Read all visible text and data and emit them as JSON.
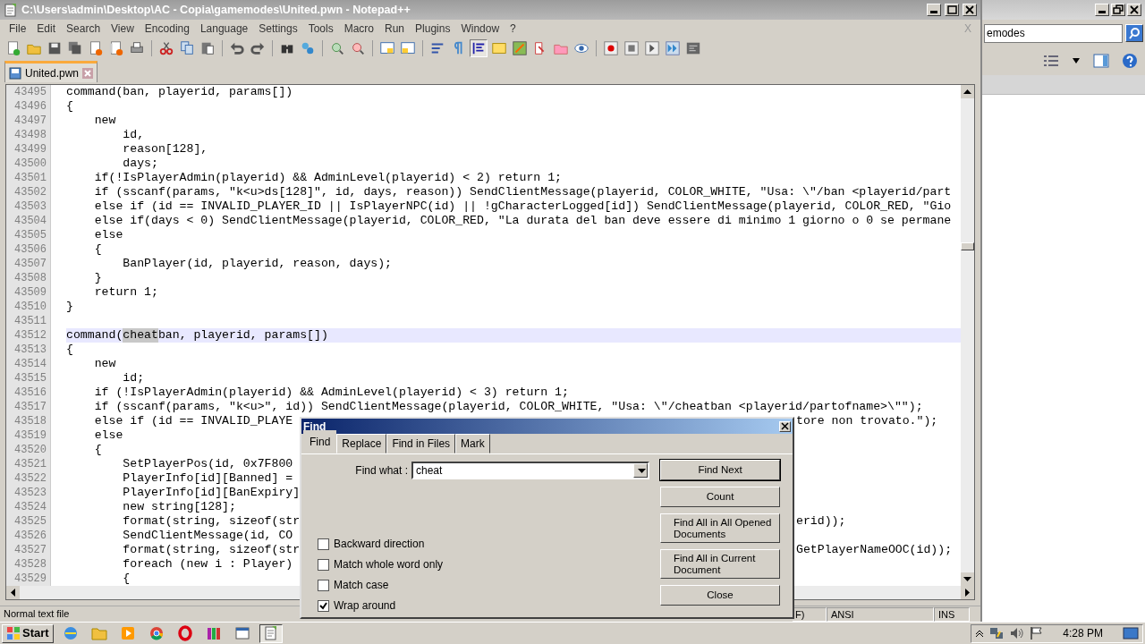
{
  "window": {
    "title": "C:\\Users\\admin\\Desktop\\AC - Copia\\gamemodes\\United.pwn - Notepad++"
  },
  "menu": [
    "File",
    "Edit",
    "Search",
    "View",
    "Encoding",
    "Language",
    "Settings",
    "Tools",
    "Macro",
    "Run",
    "Plugins",
    "Window",
    "?"
  ],
  "close_document": "X",
  "toolbar": {
    "indent_guide_pressed": true
  },
  "tabs": [
    {
      "label": "United.pwn",
      "selected": true
    }
  ],
  "editor": {
    "lines": [
      {
        "number": "43495",
        "text": "command(ban, playerid, params[])",
        "current": false
      },
      {
        "number": "43496",
        "text": "{",
        "current": false
      },
      {
        "number": "43497",
        "text": "    new",
        "current": false
      },
      {
        "number": "43498",
        "text": "        id,",
        "current": false
      },
      {
        "number": "43499",
        "text": "        reason[128],",
        "current": false
      },
      {
        "number": "43500",
        "text": "        days;",
        "current": false
      },
      {
        "number": "43501",
        "text": "    if(!IsPlayerAdmin(playerid) && AdminLevel(playerid) < 2) return 1;",
        "current": false
      },
      {
        "number": "43502",
        "text": "    if (sscanf(params, \"k<u>ds[128]\", id, days, reason)) SendClientMessage(playerid, COLOR_WHITE, \"Usa: \\\"/ban <playerid/part",
        "current": false
      },
      {
        "number": "43503",
        "text": "    else if (id == INVALID_PLAYER_ID || IsPlayerNPC(id) || !gCharacterLogged[id]) SendClientMessage(playerid, COLOR_RED, \"Gio",
        "current": false
      },
      {
        "number": "43504",
        "text": "    else if(days < 0) SendClientMessage(playerid, COLOR_RED, \"La durata del ban deve essere di minimo 1 giorno o 0 se permane",
        "current": false
      },
      {
        "number": "43505",
        "text": "    else",
        "current": false
      },
      {
        "number": "43506",
        "text": "    {",
        "current": false
      },
      {
        "number": "43507",
        "text": "        BanPlayer(id, playerid, reason, days);",
        "current": false
      },
      {
        "number": "43508",
        "text": "    }",
        "current": false
      },
      {
        "number": "43509",
        "text": "    return 1;",
        "current": false
      },
      {
        "number": "43510",
        "text": "}",
        "current": false
      },
      {
        "number": "43511",
        "current": false
      },
      {
        "number": "43512",
        "parts": [
          {
            "text": "command(",
            "match": false
          },
          {
            "text": "cheat",
            "match": true
          },
          {
            "text": "ban, playerid, params[])",
            "match": false
          }
        ],
        "current": true
      },
      {
        "number": "43513",
        "text": "{",
        "current": false
      },
      {
        "number": "43514",
        "text": "    new",
        "current": false
      },
      {
        "number": "43515",
        "text": "        id;",
        "current": false
      },
      {
        "number": "43516",
        "text": "    if (!IsPlayerAdmin(playerid) && AdminLevel(playerid) < 3) return 1;",
        "current": false
      },
      {
        "number": "43517",
        "text": "    if (sscanf(params, \"k<u>\", id)) SendClientMessage(playerid, COLOR_WHITE, \"Usa: \\\"/cheatban <playerid/partofname>\\\"\");",
        "current": false
      },
      {
        "number": "43518",
        "text": "    else if (id == INVALID_PLAYE",
        "tail": "tore non trovato.\");",
        "current": false
      },
      {
        "number": "43519",
        "text": "    else",
        "current": false
      },
      {
        "number": "43520",
        "text": "    {",
        "current": false
      },
      {
        "number": "43521",
        "text": "        SetPlayerPos(id, 0x7F800",
        "current": false
      },
      {
        "number": "43522",
        "text": "        PlayerInfo[id][Banned] =",
        "current": false
      },
      {
        "number": "43523",
        "text": "        PlayerInfo[id][BanExpiry]",
        "current": false
      },
      {
        "number": "43524",
        "text": "        new string[128];",
        "current": false
      },
      {
        "number": "43525",
        "text": "        format(string, sizeof(str",
        "tail": "erid));",
        "current": false
      },
      {
        "number": "43526",
        "text": "        SendClientMessage(id, CO",
        "current": false
      },
      {
        "number": "43527",
        "text": "        format(string, sizeof(str",
        "tail": "GetPlayerNameOOC(id));",
        "current": false
      },
      {
        "number": "43528",
        "text": "        foreach (new i : Player)",
        "current": false
      },
      {
        "number": "43529",
        "text": "        {",
        "current": false
      }
    ]
  },
  "status_bar": {
    "file_type": "Normal text file",
    "column_2": "F)",
    "encoding": "ANSI",
    "mode": "INS"
  },
  "find_dialog": {
    "title": "Find",
    "tabs": [
      {
        "label": "Find",
        "selected": true
      },
      {
        "label": "Replace",
        "selected": false
      },
      {
        "label": "Find in Files",
        "selected": false
      },
      {
        "label": "Mark",
        "selected": false
      }
    ],
    "find_what_label": "Find what :",
    "find_what_value": "cheat",
    "options": [
      {
        "label": "Backward direction",
        "checked": false
      },
      {
        "label": "Match whole word only",
        "checked": false
      },
      {
        "label": "Match case",
        "checked": false
      },
      {
        "label": "Wrap around",
        "checked": true
      }
    ],
    "buttons": [
      {
        "label": "Find Next",
        "default": true
      },
      {
        "label": "Count",
        "default": false
      },
      {
        "label": "Find All in All Opened Documents",
        "default": false
      },
      {
        "label": "Find All in Current Document",
        "default": false
      },
      {
        "label": "Close",
        "default": false
      }
    ]
  },
  "explorer": {
    "search_value": "emodes"
  },
  "taskbar": {
    "start": "Start",
    "clock": "4:28 PM"
  }
}
